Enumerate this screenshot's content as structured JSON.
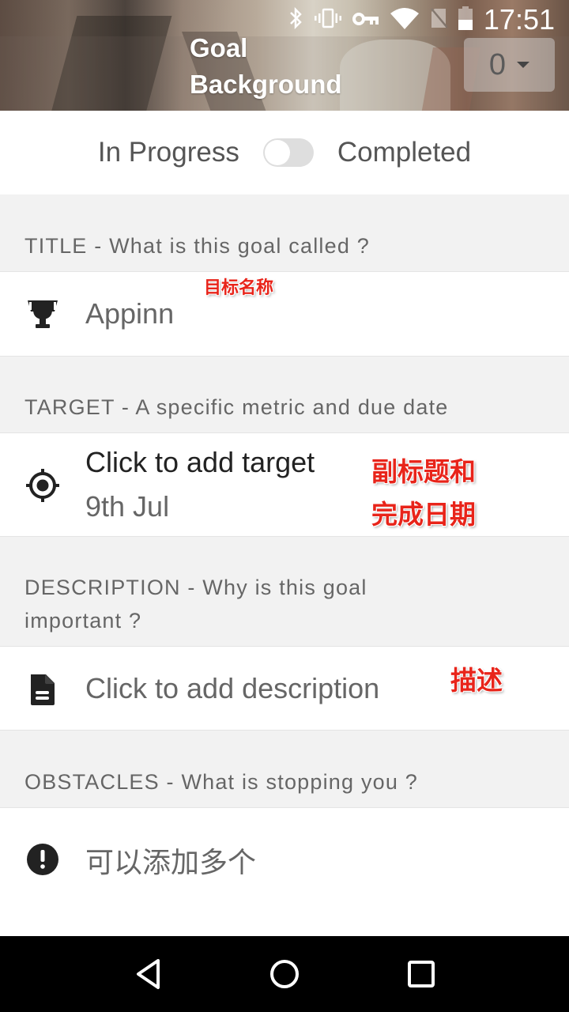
{
  "status_bar": {
    "icons": [
      "bluetooth-icon",
      "vibrate-icon",
      "vpn-key-icon",
      "wifi-icon",
      "no-sim-icon",
      "battery-icon"
    ],
    "time": "17:51"
  },
  "header": {
    "title_line1": "Goal",
    "title_line2": "Background",
    "count_value": "0"
  },
  "status_toggle": {
    "left_label": "In Progress",
    "right_label": "Completed",
    "completed": false
  },
  "sections": {
    "title": {
      "header": "TITLE - What is this goal called ?",
      "value": "Appinn",
      "icon": "trophy-icon",
      "annotation": "目标名称"
    },
    "target": {
      "header": "TARGET - A specific metric and due date",
      "value": "Click to add target",
      "due_date": "9th Jul",
      "icon": "target-icon",
      "annotation_line1": "副标题和",
      "annotation_line2": "完成日期"
    },
    "description": {
      "header_line1": "DESCRIPTION - Why is this goal",
      "header_line2": "important ?",
      "value": "Click to add description",
      "icon": "document-icon",
      "annotation": "描述"
    },
    "obstacles": {
      "header": "OBSTACLES - What is stopping you ?",
      "value": "可以添加多个",
      "icon": "alert-circle-icon"
    }
  },
  "nav_bar": {
    "buttons": [
      "back-icon",
      "home-icon",
      "recents-icon"
    ]
  },
  "colors": {
    "annotation_red": "#e8241a",
    "section_bg": "#f2f2f2",
    "text_gray": "#666666"
  }
}
